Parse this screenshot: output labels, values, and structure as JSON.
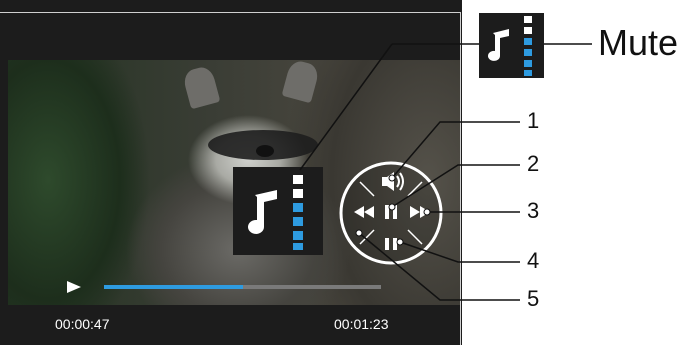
{
  "player": {
    "current_time": "00:00:47",
    "total_time": "00:01:23",
    "progress": 0.5
  },
  "labels": {
    "mute": "Mute",
    "callout_1": "1",
    "callout_2": "2",
    "callout_3": "3",
    "callout_4": "4",
    "callout_5": "5"
  },
  "icons": {
    "play": "play-icon",
    "audio_track": "music-note-icon",
    "volume": "volume-icon",
    "pause": "pause-icon",
    "forward": "fast-forward-icon",
    "rewind": "rewind-icon",
    "audio_mute": "audio-mute-icon"
  },
  "colors": {
    "accent": "#2e9be0",
    "panel": "#1c1c1c"
  }
}
